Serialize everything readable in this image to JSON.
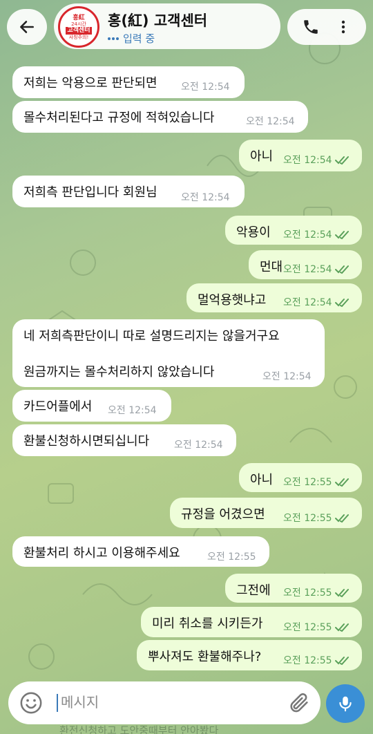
{
  "header": {
    "title": "홍(紅) 고객센터",
    "status": "입력 중",
    "avatar": {
      "line1": "홍紅",
      "line2": "24시간",
      "line3": "고객센터",
      "line4": "사칭주의!"
    },
    "icons": {
      "back": "arrow-left-icon",
      "call": "phone-icon",
      "menu": "more-vertical-icon"
    }
  },
  "messages": [
    {
      "dir": "in",
      "text": "저희는 악용으로 판단되면",
      "time": "오전 12:54"
    },
    {
      "dir": "in",
      "text": "몰수처리된다고 규정에 적혀있습니다",
      "time": "오전 12:54"
    },
    {
      "dir": "out",
      "text": "아니",
      "time": "오전 12:54"
    },
    {
      "dir": "in",
      "text": "저희측 판단입니다 회원님",
      "time": "오전 12:54"
    },
    {
      "dir": "out",
      "text": "악용이",
      "time": "오전 12:54"
    },
    {
      "dir": "out",
      "text": "먼대",
      "time": "오전 12:54"
    },
    {
      "dir": "out",
      "text": "멀억용햇냐고",
      "time": "오전 12:54"
    },
    {
      "dir": "in",
      "text": "네 저희측판단이니 따로 설명드리지는 않을거구요",
      "text2": "원금까지는 몰수처리하지 않았습니다",
      "time": "오전 12:54"
    },
    {
      "dir": "in",
      "text": "카드어플에서",
      "time": "오전 12:54"
    },
    {
      "dir": "in",
      "text": "환불신청하시면되십니다",
      "time": "오전 12:54"
    },
    {
      "dir": "out",
      "text": "아니",
      "time": "오전 12:55"
    },
    {
      "dir": "out",
      "text": "규정을 어겼으면",
      "time": "오전 12:55"
    },
    {
      "dir": "in",
      "text": "환불처리 하시고 이용해주세요",
      "time": "오전 12:55"
    },
    {
      "dir": "out",
      "text": "그전에",
      "time": "오전 12:55"
    },
    {
      "dir": "out",
      "text": "미리 취소를 시키든가",
      "time": "오전 12:55"
    },
    {
      "dir": "out",
      "text": "뿌사져도 환불해주나?",
      "time": "오전 12:55"
    }
  ],
  "input": {
    "placeholder": "메시지"
  },
  "peek_text": "환전신청하고 도안중때부터 안아봤다",
  "colors": {
    "accent": "#3a8fd6",
    "outgoing_bubble": "#eefdd9",
    "incoming_bubble": "#ffffff",
    "read_check": "#5aa05a"
  }
}
